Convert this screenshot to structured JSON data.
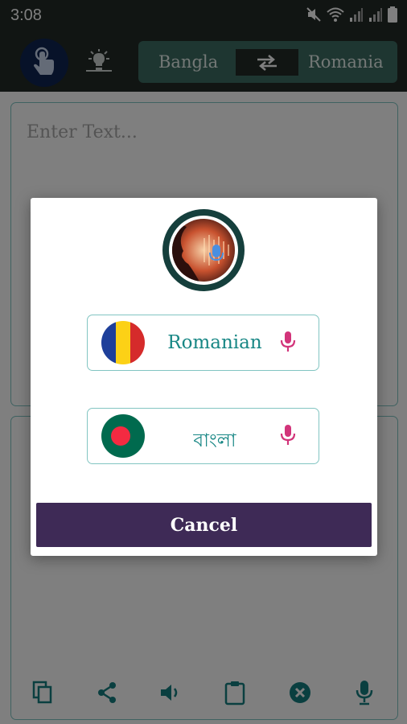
{
  "status_bar": {
    "time": "3:08"
  },
  "header": {
    "touch_icon": "touch-hand-icon",
    "bulb_icon": "lightbulb-icon",
    "source_language": "Bangla",
    "swap_icon": "swap-arrows-icon",
    "target_language": "Romania"
  },
  "input": {
    "placeholder": "Enter Text..."
  },
  "toolbar": {
    "items": [
      "copy-icon",
      "share-icon",
      "speaker-icon",
      "clipboard-icon",
      "clear-icon",
      "mic-icon"
    ]
  },
  "dialog": {
    "options": [
      {
        "label": "Romanian",
        "flag": "romania-flag-icon",
        "mic_icon": "mic-icon"
      },
      {
        "label": "বাংলা",
        "flag": "bangladesh-flag-icon",
        "mic_icon": "mic-icon"
      }
    ],
    "cancel_label": "Cancel"
  },
  "colors": {
    "header_bg": "#222a27",
    "lang_bar": "#3c6c62",
    "touch_circle": "#0e2552",
    "accent_teal": "#188785",
    "mic_pink": "#d2347a",
    "cancel_bg": "#3e2a56"
  }
}
